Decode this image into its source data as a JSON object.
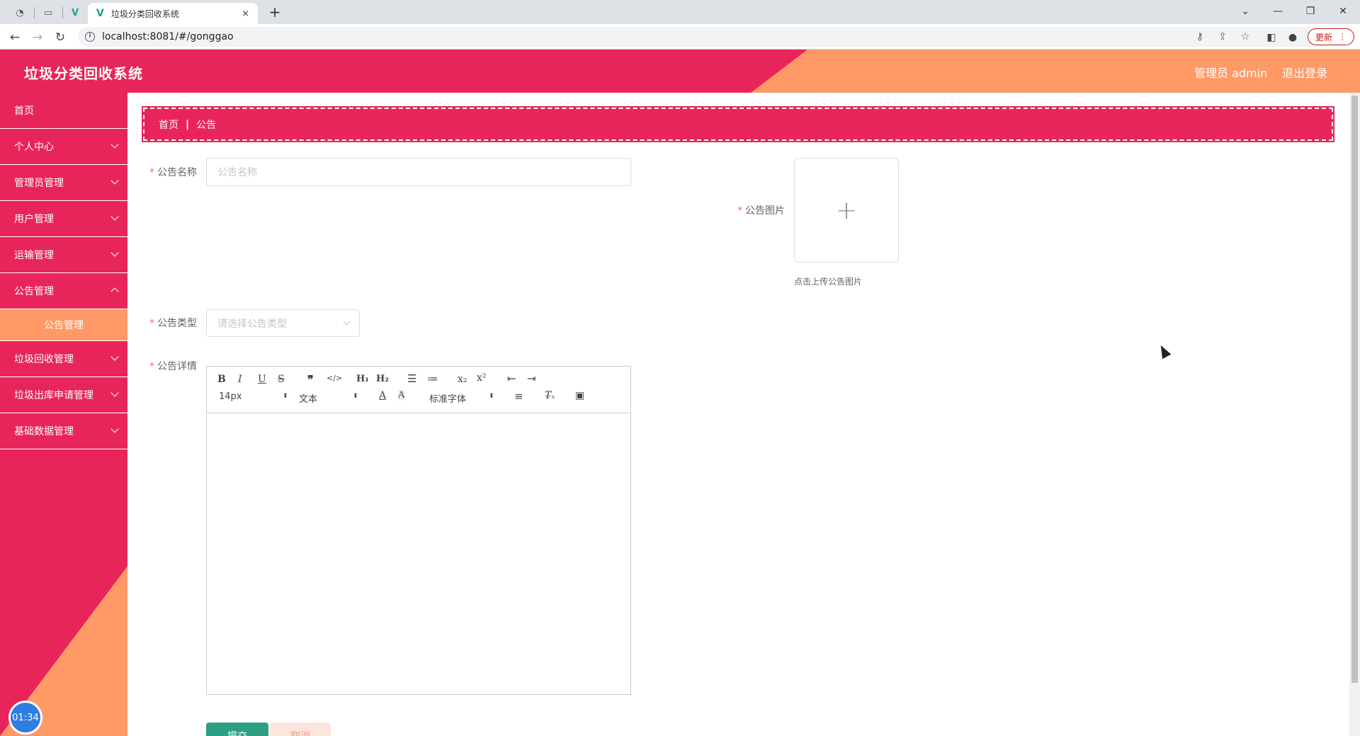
{
  "browser": {
    "tab_title": "垃圾分类回收系统",
    "tab_close": "×",
    "new_tab": "+",
    "url": "localhost:8081/#/gonggao",
    "update_label": "更新",
    "window_controls": [
      "⌄",
      "—",
      "❐",
      "✕"
    ]
  },
  "header": {
    "title": "垃圾分类回收系统",
    "user": "管理员 admin",
    "logout": "退出登录"
  },
  "sidebar": {
    "items": [
      {
        "label": "首页"
      },
      {
        "label": "个人中心"
      },
      {
        "label": "管理员管理"
      },
      {
        "label": "用户管理"
      },
      {
        "label": "运输管理"
      },
      {
        "label": "公告管理"
      },
      {
        "label": "公告管理"
      },
      {
        "label": "垃圾回收管理"
      },
      {
        "label": "垃圾出库申请管理"
      },
      {
        "label": "基础数据管理"
      }
    ],
    "timer": "01:34"
  },
  "breadcrumb": {
    "home": "首页",
    "separator": "|",
    "current": "公告"
  },
  "form": {
    "required_mark": "*",
    "name_label": "公告名称",
    "name_placeholder": "公告名称",
    "image_label": "公告图片",
    "upload_plus": "+",
    "upload_tip": "点击上传公告图片",
    "type_label": "公告类型",
    "type_placeholder": "请选择公告类型",
    "detail_label": "公告详情",
    "submit": "提交",
    "cancel": "取消"
  },
  "editor": {
    "font_size": "14px",
    "text_style": "文本",
    "font_family": "标准字体",
    "updown": "⬍"
  },
  "colors": {
    "primary": "#e8255a",
    "accent": "#ff9a66",
    "submit": "#2c9e83"
  }
}
